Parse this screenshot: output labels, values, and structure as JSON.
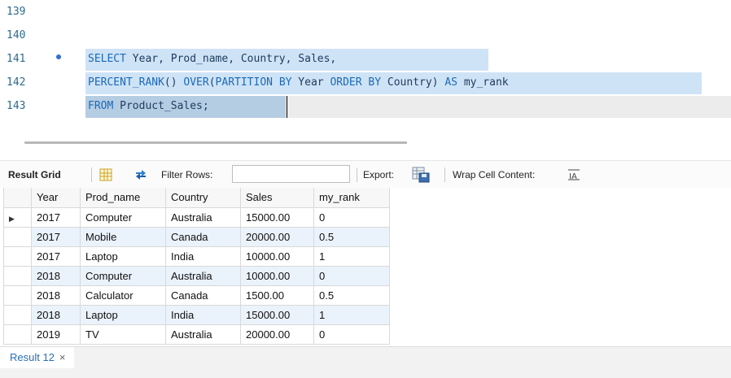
{
  "editor": {
    "lines": [
      {
        "num": "139"
      },
      {
        "num": "140"
      },
      {
        "num": "141"
      },
      {
        "num": "142"
      },
      {
        "num": "143"
      }
    ],
    "l141": {
      "kw1": "SELECT",
      "rest": " Year, Prod_name, Country, Sales,"
    },
    "l142": {
      "kw1": "PERCENT_RANK",
      "p1": "() ",
      "kw2": "OVER",
      "p2": "(",
      "kw3": "PARTITION BY",
      "p3": " Year ",
      "kw4": "ORDER BY",
      "p4": " Country) ",
      "kw5": "AS",
      "p5": " my_rank"
    },
    "l143": {
      "kw1": "FROM",
      "rest": " Product_Sales;"
    }
  },
  "toolbar": {
    "result_grid": "Result Grid",
    "filter_rows": "Filter Rows:",
    "filter_value": "",
    "export": "Export:",
    "wrap": "Wrap Cell Content:"
  },
  "grid": {
    "columns": [
      "Year",
      "Prod_name",
      "Country",
      "Sales",
      "my_rank"
    ],
    "rows": [
      [
        "2017",
        "Computer",
        "Australia",
        "15000.00",
        "0"
      ],
      [
        "2017",
        "Mobile",
        "Canada",
        "20000.00",
        "0.5"
      ],
      [
        "2017",
        "Laptop",
        "India",
        "10000.00",
        "1"
      ],
      [
        "2018",
        "Computer",
        "Australia",
        "10000.00",
        "0"
      ],
      [
        "2018",
        "Calculator",
        "Canada",
        "1500.00",
        "0.5"
      ],
      [
        "2018",
        "Laptop",
        "India",
        "15000.00",
        "1"
      ],
      [
        "2019",
        "TV",
        "Australia",
        "20000.00",
        "0"
      ]
    ]
  },
  "tabs": {
    "result": "Result 12",
    "close": "×"
  },
  "colors": {
    "keyword": "#1a6ab8",
    "selection": "#cfe3f6",
    "alt_row": "#eaf2fb",
    "tab_text": "#2a6fb8"
  }
}
